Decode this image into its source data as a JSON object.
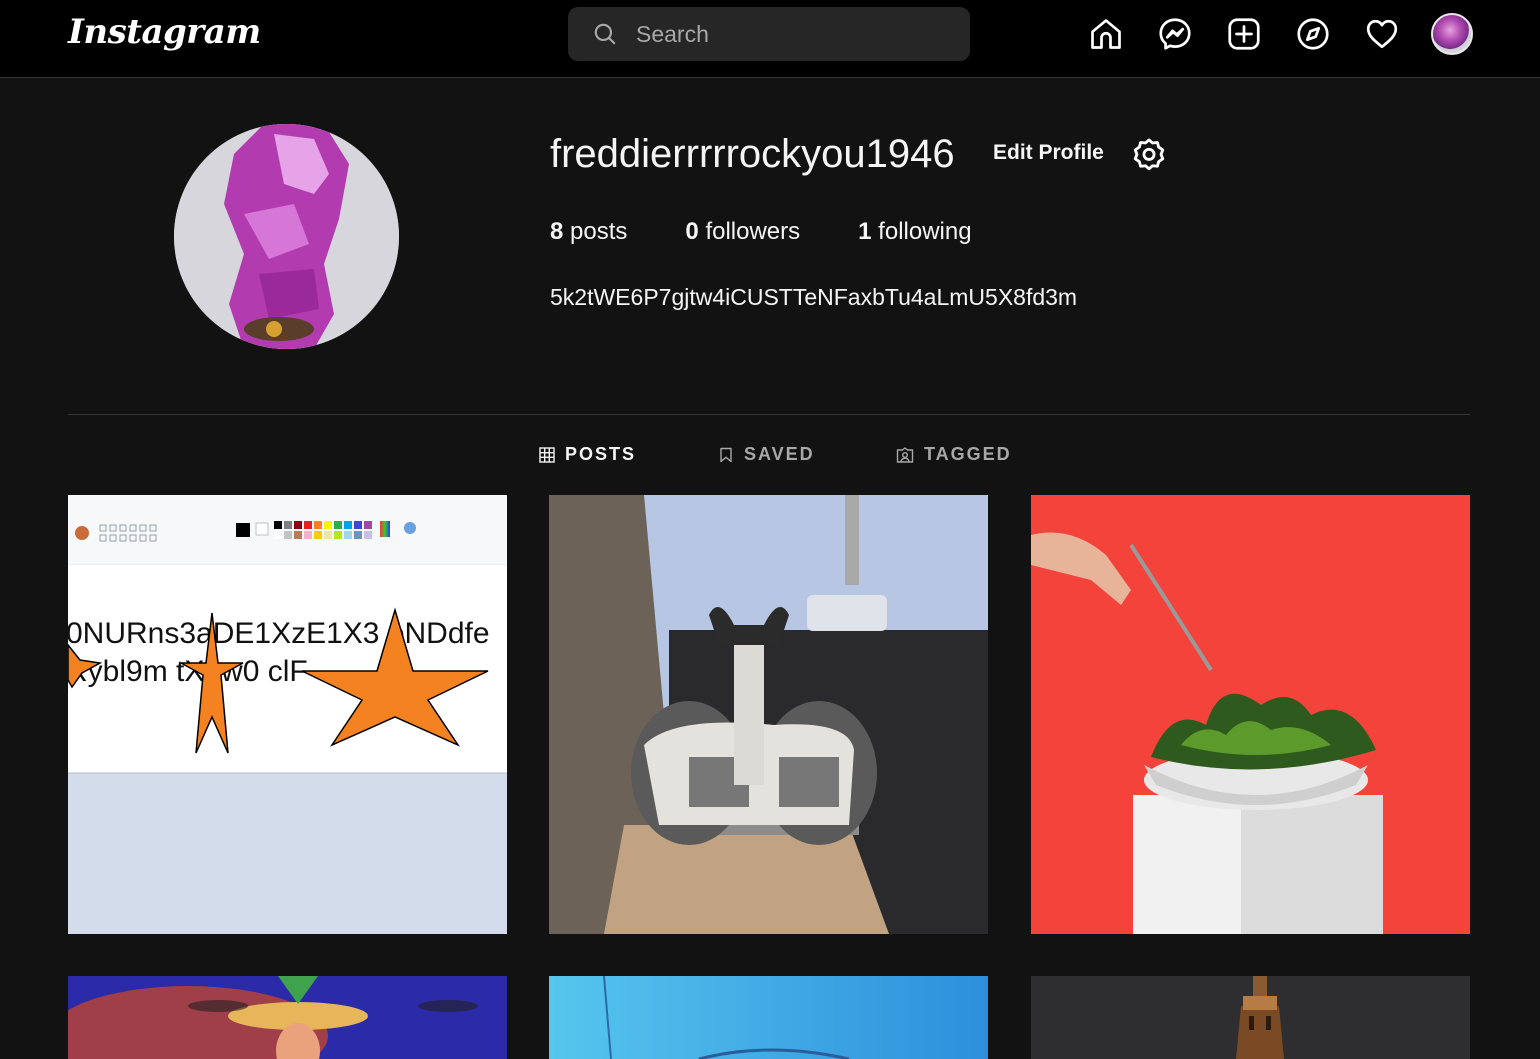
{
  "app": {
    "logo": "Instagram"
  },
  "search": {
    "placeholder": "Search"
  },
  "nav": {
    "icons": [
      "home-icon",
      "messenger-icon",
      "new-post-icon",
      "explore-icon",
      "activity-heart-icon",
      "profile-avatar"
    ]
  },
  "profile": {
    "username": "freddierrrrrockyou1946",
    "edit_label": "Edit Profile",
    "posts_count": "8",
    "posts_label": "posts",
    "followers_count": "0",
    "followers_label": "followers",
    "following_count": "1",
    "following_label": "following",
    "bio": "5k2tWE6P7gjtw4iCUSTTeNFaxbTu4aLmU5X8fd3m"
  },
  "tabs": [
    {
      "label": "POSTS",
      "active": true,
      "icon": "grid-icon"
    },
    {
      "label": "SAVED",
      "active": false,
      "icon": "bookmark-icon"
    },
    {
      "label": "TAGGED",
      "active": false,
      "icon": "tagged-icon"
    }
  ],
  "posts": {
    "p1": {
      "line1": "0NURns3aDE1XzE1X3 oNDdfe",
      "line2": "Rybl9m  tX2w0   clF"
    }
  },
  "colors": {
    "background": "#121212",
    "topbar": "#000000",
    "search_bg": "#262626",
    "divider": "#363636",
    "muted": "#a8a8a8"
  }
}
